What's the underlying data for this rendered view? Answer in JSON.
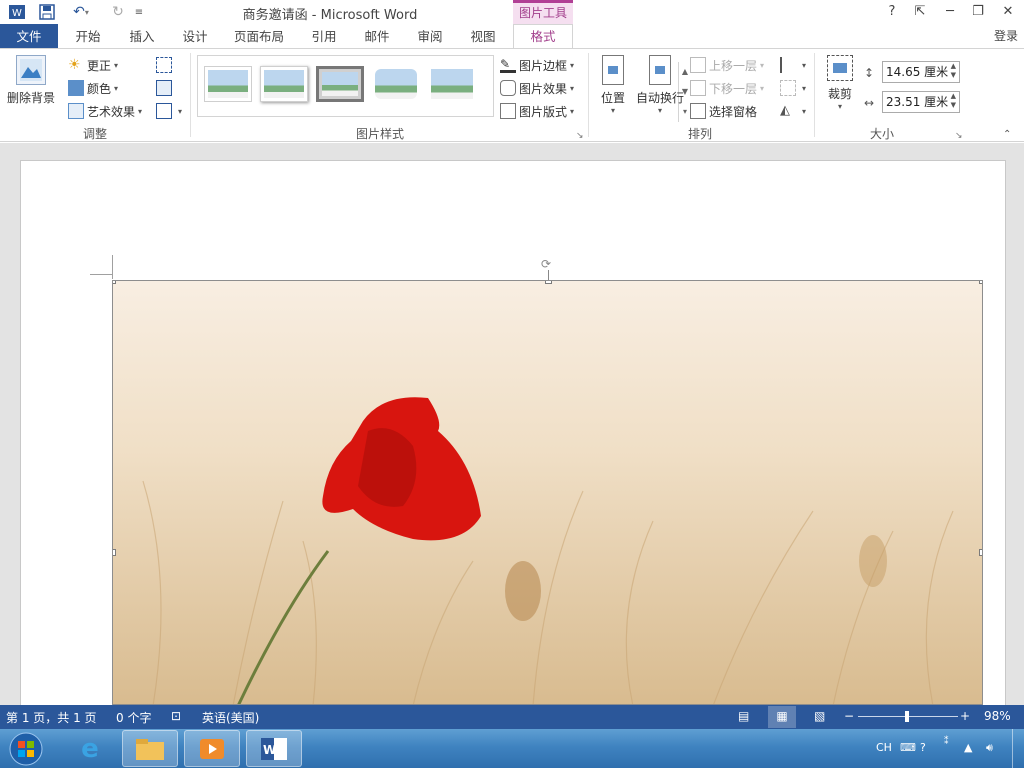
{
  "app": {
    "title": "商务邀请函 - Microsoft Word",
    "context_tab": "图片工具",
    "window_buttons": [
      "?",
      "⇱",
      "─",
      "❐",
      "✕"
    ],
    "login": "登录"
  },
  "tabs": [
    "文件",
    "开始",
    "插入",
    "设计",
    "页面布局",
    "引用",
    "邮件",
    "审阅",
    "视图",
    "格式"
  ],
  "ribbon": {
    "adjust": {
      "remove_bg": "删除背景",
      "corrections": "更正",
      "color": "颜色",
      "artistic": "艺术效果",
      "label": "调整"
    },
    "styles": {
      "label": "图片样式",
      "border": "图片边框",
      "effects": "图片效果",
      "layout": "图片版式"
    },
    "arrange": {
      "position": "位置",
      "wrap": "自动换行",
      "bring_forward": "上移一层",
      "send_backward": "下移一层",
      "selection_pane": "选择窗格",
      "label": "排列"
    },
    "size": {
      "crop": "裁剪",
      "height": "14.65 厘米",
      "width": "23.51 厘米",
      "label": "大小"
    }
  },
  "statusbar": {
    "page": "第 1 页，共 1 页",
    "words": "0 个字",
    "language": "英语(美国)",
    "zoom": "98%",
    "zoom_level": 0.49
  },
  "taskbar": {
    "tray_lang": "CH"
  },
  "colors": {
    "word_blue": "#2b579a",
    "context_magenta": "#a23f8c"
  }
}
